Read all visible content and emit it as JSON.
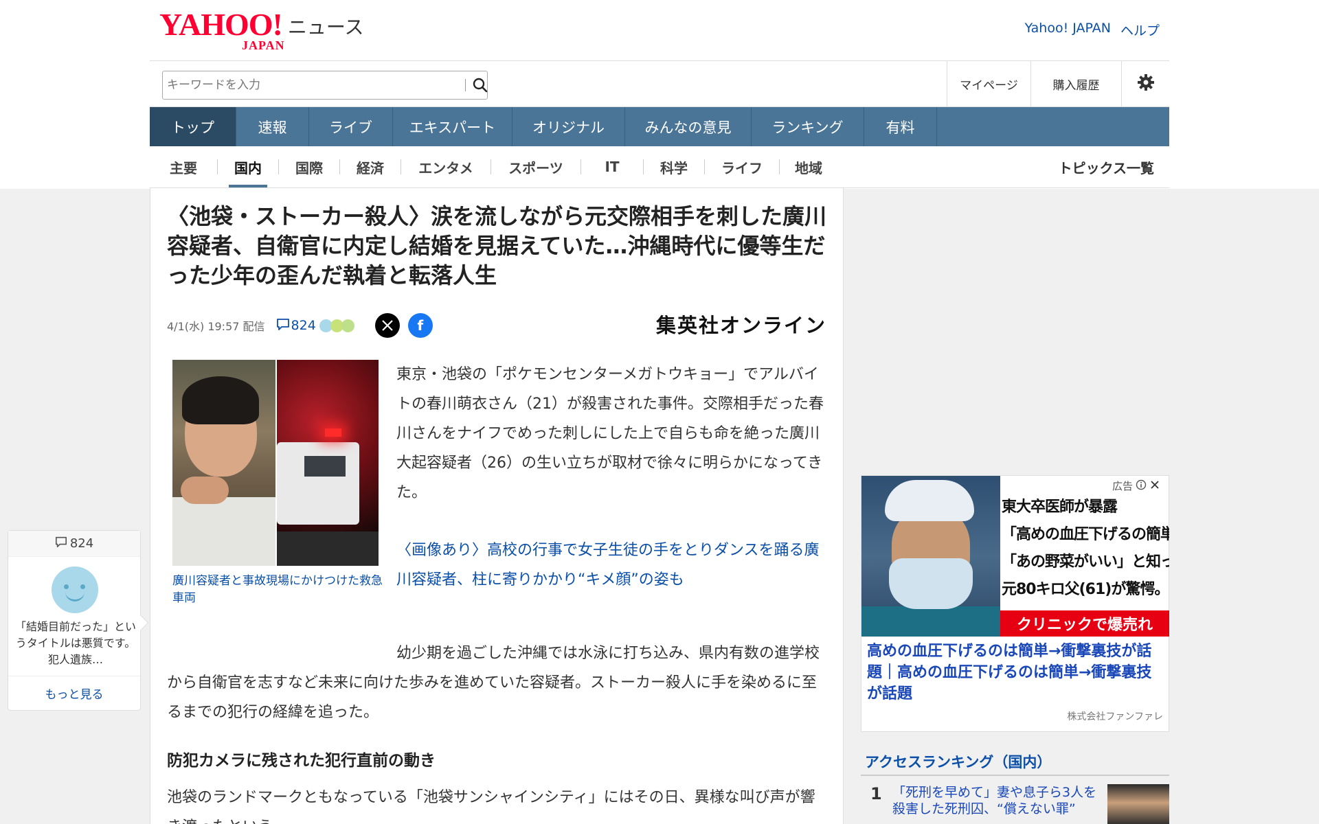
{
  "header": {
    "logo_yahoo": "YAHOO!",
    "logo_japan": "JAPAN",
    "logo_news": "ニュース",
    "link_yahoo_japan": "Yahoo! JAPAN",
    "link_help": "ヘルプ"
  },
  "search": {
    "placeholder": "キーワードを入力"
  },
  "usermenu": {
    "mypage": "マイページ",
    "purchases": "購入履歴"
  },
  "gnav": [
    "トップ",
    "速報",
    "ライブ",
    "エキスパート",
    "オリジナル",
    "みんなの意見",
    "ランキング",
    "有料"
  ],
  "subnav": {
    "categories": [
      "主要",
      "国内",
      "国際",
      "経済",
      "エンタメ",
      "スポーツ",
      "IT",
      "科学",
      "ライフ",
      "地域"
    ],
    "active_index": 1,
    "topics_link": "トピックス一覧"
  },
  "article": {
    "title": "〈池袋・ストーカー殺人〉涙を流しながら元交際相手を刺した廣川容疑者、自衛官に内定し結婚を見据えていた…沖縄時代に優等生だった少年の歪んだ執着と転落人生",
    "date": "4/1(水) 19:57 配信",
    "comment_count": "824",
    "media": "集英社オンライン",
    "photo_caption": "廣川容疑者と事故現場にかけつけた救急車両",
    "p1": "東京・池袋の「ポケモンセンターメガトウキョー」でアルバイトの春川萌衣さん（21）が殺害された事件。交際相手だった春川さんをナイフでめった刺しにした上で自らも命を絶った廣川大起容疑者（26）の生い立ちが取材で徐々に明らかになってきた。",
    "link1": "〈画像あり〉高校の行事で女子生徒の手をとりダンスを踊る廣川容疑者、柱に寄りかかり“キメ顔”の姿も",
    "p2": "幼少期を過ごした沖縄では水泳に打ち込み、県内有数の進学校から自衛官を志すなど未来に向けた歩みを進めていた容疑者。ストーカー殺人に手を染めるに至るまでの犯行の経緯を追った。",
    "h2": "防犯カメラに残された犯行直前の動き",
    "p3": "池袋のランドマークともなっている「池袋サンシャインシティ」にはその日、異様な叫び声が響き渡ったという。"
  },
  "comment_widget": {
    "count": "824",
    "text": "「結婚目前だった」というタイトルは悪質です。犯人遺族…",
    "more": "もっと見る"
  },
  "ad": {
    "label": "広告",
    "copy_lines": [
      "東大卒医師が暴露",
      "「高めの血圧下げるの簡単」",
      "「あの野菜がいい」と知った",
      "元80キロ父(61)が驚愕。"
    ],
    "cta": "クリニックで爆売れ",
    "headline": "高めの血圧下げるのは簡単→衝撃裏技が話題｜高めの血圧下げるのは簡単→衝撃裏技が話題",
    "sponsor": "株式会社ファンファレ"
  },
  "ranking": {
    "title": "アクセスランキング（国内）",
    "items": [
      {
        "rank": "1",
        "title": "「死刑を早めて」妻や息子ら3人を殺害した死刑囚、“償えない罪”"
      }
    ]
  },
  "colors": {
    "nav_blue": "#4b7596",
    "nav_active": "#2b4a63",
    "link_blue": "#0b4fa8",
    "logo_red": "#ff0033",
    "ad_red": "#e60012"
  }
}
